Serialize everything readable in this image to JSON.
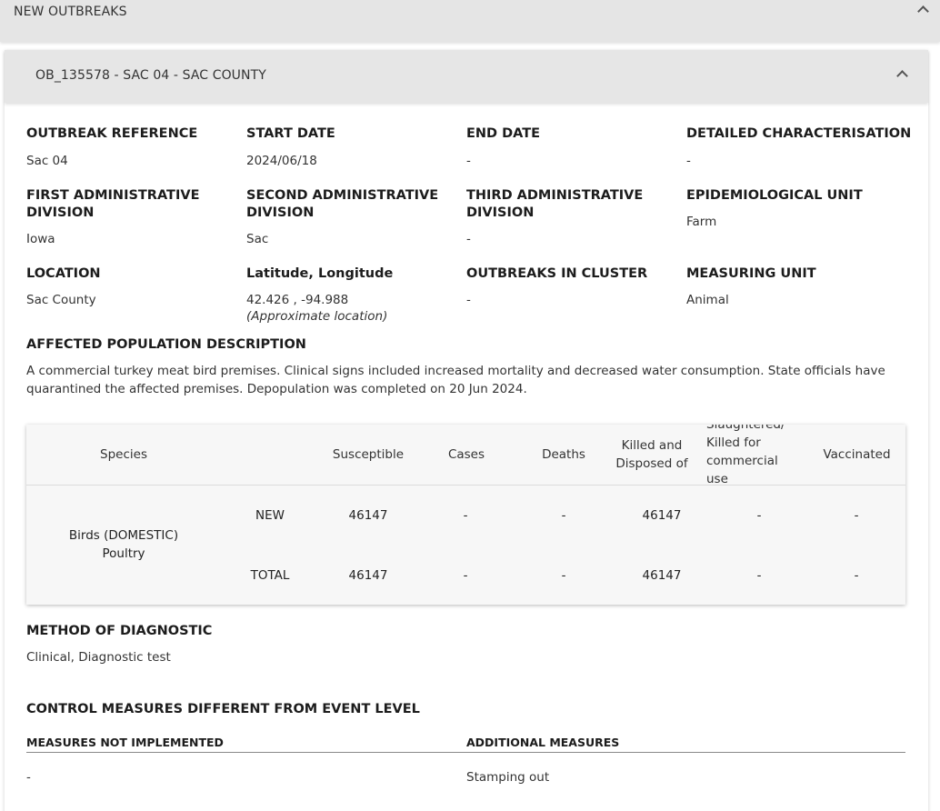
{
  "top_bar": {
    "title": "NEW OUTBREAKS"
  },
  "outbreak": {
    "header_title": "OB_135578 - SAC 04 - SAC COUNTY",
    "fields": {
      "outbreak_reference": {
        "label": "OUTBREAK REFERENCE",
        "value": "Sac 04"
      },
      "start_date": {
        "label": "START DATE",
        "value": "2024/06/18"
      },
      "end_date": {
        "label": "END DATE",
        "value": "-"
      },
      "detailed_characterisation": {
        "label": "DETAILED CHARACTERISATION",
        "value": "-"
      },
      "first_admin_line1": "FIRST ADMINISTRATIVE",
      "first_admin_line2": "DIVISION",
      "first_admin_value": "Iowa",
      "second_admin_line1": "SECOND ADMINISTRATIVE",
      "second_admin_line2": "DIVISION",
      "second_admin_value": "Sac",
      "third_admin_line1": "THIRD ADMINISTRATIVE",
      "third_admin_line2": "DIVISION",
      "third_admin_value": "-",
      "epi_unit": {
        "label": "EPIDEMIOLOGICAL UNIT",
        "value": "Farm"
      },
      "location": {
        "label": "LOCATION",
        "value": "Sac County"
      },
      "lat_long": {
        "label": "Latitude, Longitude",
        "value": "42.426 , -94.988",
        "note": "(Approximate location)"
      },
      "outbreaks_in_cluster": {
        "label": "OUTBREAKS IN CLUSTER",
        "value": "-"
      },
      "measuring_unit": {
        "label": "MEASURING UNIT",
        "value": "Animal"
      }
    },
    "affected_population": {
      "label": "AFFECTED POPULATION DESCRIPTION",
      "text": "A commercial turkey meat bird premises. Clinical signs included increased mortality and decreased water consumption. State officials have quarantined the affected premises. Depopulation was completed on 20 Jun 2024."
    },
    "table": {
      "headers": {
        "species": "Species",
        "susceptible": "Susceptible",
        "cases": "Cases",
        "deaths": "Deaths",
        "killed": "Killed and Disposed of",
        "slaughtered": "Slaughtered/ Killed for commercial use",
        "vaccinated": "Vaccinated"
      },
      "species_line1": "Birds (DOMESTIC)",
      "species_line2": "Poultry",
      "rows": [
        {
          "label": "NEW",
          "susceptible": "46147",
          "cases": "-",
          "deaths": "-",
          "killed": "46147",
          "slaughtered": "-",
          "vaccinated": "-"
        },
        {
          "label": "TOTAL",
          "susceptible": "46147",
          "cases": "-",
          "deaths": "-",
          "killed": "46147",
          "slaughtered": "-",
          "vaccinated": "-"
        }
      ]
    },
    "method_of_diagnostic": {
      "label": "METHOD OF DIAGNOSTIC",
      "value": "Clinical, Diagnostic test"
    },
    "control_measures": {
      "label": "CONTROL MEASURES DIFFERENT FROM EVENT LEVEL",
      "not_implemented_label": "MEASURES NOT IMPLEMENTED",
      "not_implemented_value": "-",
      "additional_label": "ADDITIONAL MEASURES",
      "additional_value": "Stamping out"
    }
  }
}
